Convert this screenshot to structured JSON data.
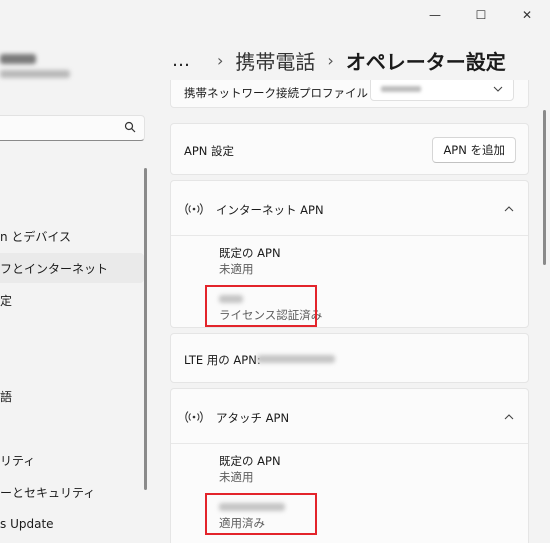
{
  "window": {
    "min_icon": "minimize-icon",
    "max_icon": "maximize-icon",
    "close_icon": "close-icon",
    "min_glyph": "—",
    "max_glyph": "☐",
    "close_glyph": "✕"
  },
  "sidebar": {
    "items": [
      {
        "label": "n とデバイス"
      },
      {
        "label": "フとインターネット",
        "selected": true
      },
      {
        "label": "定"
      },
      {
        "label": "語"
      },
      {
        "label": "リティ"
      },
      {
        "label": "ーとセキュリティ"
      },
      {
        "label": "s Update"
      }
    ]
  },
  "breadcrumb": {
    "more": "…",
    "sep": "›",
    "parent": "携帯電話",
    "current": "オペレーター設定"
  },
  "network_profile": {
    "label": "携帯ネットワーク接続プロファイル"
  },
  "apn_settings": {
    "label": "APN 設定",
    "add_button": "APN を追加"
  },
  "internet_apn": {
    "title": "インターネット APN",
    "default_title": "既定の APN",
    "default_value": "未適用",
    "license_value": "ライセンス認証済み"
  },
  "lte": {
    "label": "LTE 用の APN:"
  },
  "attach_apn": {
    "title": "アタッチ APN",
    "default_title": "既定の APN",
    "default_value": "未適用",
    "applied_value": "適用済み"
  },
  "colors": {
    "highlight": "#e3242b",
    "background": "#f3f3f3",
    "card": "#fbfbfb"
  }
}
